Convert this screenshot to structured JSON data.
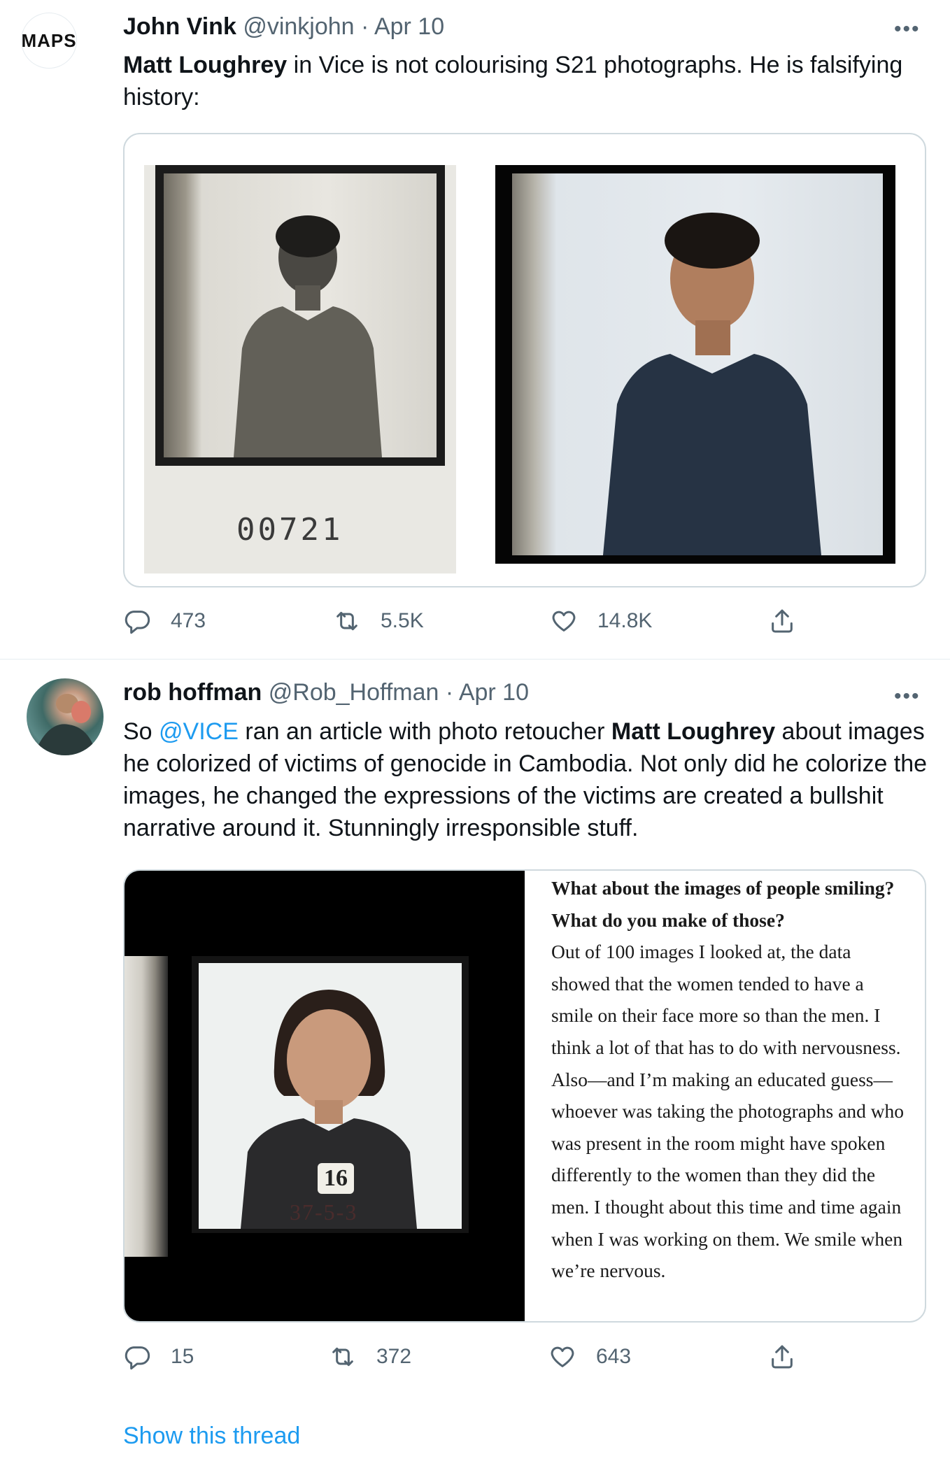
{
  "tweets": [
    {
      "avatar_text": "MAPS",
      "display_name": "John Vink",
      "handle": "@vinkjohn",
      "separator": "·",
      "date": "Apr 10",
      "more": "•••",
      "text": {
        "bold_name": "Matt Loughrey",
        "rest": " in Vice is not colourising S21 photographs. He is falsifying history:"
      },
      "photo_number": "00721",
      "stats": {
        "replies": "473",
        "retweets": "5.5K",
        "likes": "14.8K"
      }
    },
    {
      "display_name": "rob hoffman",
      "handle": "@Rob_Hoffman",
      "separator": "·",
      "date": "Apr 10",
      "more": "•••",
      "text": {
        "part1": "So ",
        "mention": "@VICE",
        "part2": " ran an article with photo retoucher ",
        "bold_name": "Matt Loughrey",
        "part3": " about images he colorized of victims of genocide in Cambodia. Not only did he colorize the images, he changed the expressions of the victims are created a bullshit narrative around it. Stunningly irresponsible stuff."
      },
      "card_quote": {
        "question": "What about the images of people smiling? What do you make of those?",
        "answer": "Out of 100 images I looked at, the data showed that the women tended to have a smile on their face more so than the men. I think a lot of that has to do with nervousness. Also—and I’m making an educated guess—whoever was taking the photographs and who was present in the room might have spoken differently to the women than they did the men. I thought about this time and time again when I was working on them. We smile when we’re nervous."
      },
      "photo_tag_number": "16",
      "photo_handwritten": "37-5-3",
      "stats": {
        "replies": "15",
        "retweets": "372",
        "likes": "643"
      },
      "show_thread": "Show this thread"
    }
  ],
  "icons": [
    "reply-icon",
    "retweet-icon",
    "like-icon",
    "share-icon",
    "more-icon"
  ],
  "colors": {
    "link": "#1d9bf0",
    "muted": "#536471",
    "border": "#cfd9de"
  }
}
